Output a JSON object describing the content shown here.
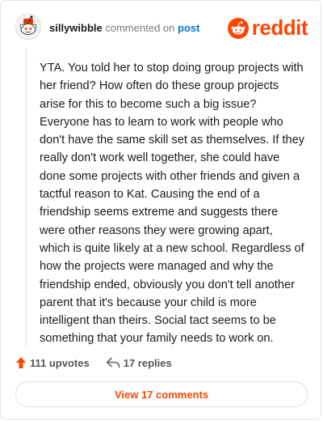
{
  "header": {
    "username": "sillywibble",
    "commented_text": "commented on",
    "post_link": "post",
    "logo_text": "reddit",
    "avatar_icon": "snoo-avatar-icon",
    "logo_icon": "reddit-snoo-icon"
  },
  "comment": {
    "body": "YTA. You told her to stop doing group projects with her friend? How often do these group projects arise for this to become such a big issue? Everyone has to learn to work with people who don't have the same skill set as themselves. If they really don't work well together, she could have done some projects with other friends and given a tactful reason to Kat. Causing the end of a friendship seems extreme and suggests there were other reasons they were growing apart, which is quite likely at a new school. Regardless of how the projects were managed and why the friendship ended, obviously you don't tell another parent that it's because your child is more intelligent than theirs. Social tact seems to be something that your family needs to work on."
  },
  "actions": {
    "upvotes": "111 upvotes",
    "replies": "17 replies",
    "upvote_icon": "upvote-arrow-icon",
    "reply_icon": "reply-arrow-icon"
  },
  "footer": {
    "view_comments": "View 17 comments"
  },
  "colors": {
    "brand": "#ff4500",
    "link": "#0079d3"
  }
}
